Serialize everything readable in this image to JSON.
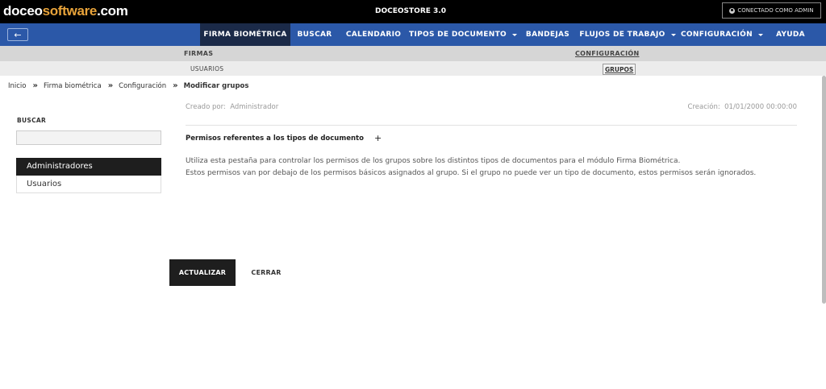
{
  "topbar": {
    "logo_main": "doceo",
    "logo_accent": "software",
    "logo_suffix": ".com",
    "app_title": "DOCEOSTORE 3.0",
    "connected_label": "CONECTADO COMO ADMIN"
  },
  "nav": {
    "items": [
      {
        "label": "FIRMA BIOMÉTRICA",
        "active": true,
        "dropdown": false
      },
      {
        "label": "BUSCAR",
        "active": false,
        "dropdown": false
      },
      {
        "label": "CALENDARIO",
        "active": false,
        "dropdown": false
      },
      {
        "label": "TIPOS DE DOCUMENTO",
        "active": false,
        "dropdown": true
      },
      {
        "label": "BANDEJAS",
        "active": false,
        "dropdown": false
      },
      {
        "label": "FLUJOS DE TRABAJO",
        "active": false,
        "dropdown": true
      },
      {
        "label": "CONFIGURACIÓN",
        "active": false,
        "dropdown": true
      },
      {
        "label": "AYUDA",
        "active": false,
        "dropdown": false
      }
    ]
  },
  "subnav": {
    "firmas": "FIRMAS",
    "configuracion": "CONFIGURACIÓN",
    "usuarios": "USUARIOS",
    "grupos": "GRUPOS"
  },
  "breadcrumb": {
    "items": [
      "Inicio",
      "Firma biométrica",
      "Configuración"
    ],
    "current": "Modificar grupos"
  },
  "sidebar": {
    "search_label": "BUSCAR",
    "search_value": "",
    "groups": [
      "Administradores",
      "Usuarios"
    ],
    "selected_index": 0
  },
  "main": {
    "created_by_label": "Creado por:",
    "created_by_value": "Administrador",
    "creation_label": "Creación:",
    "creation_value": "01/01/2000 00:00:00",
    "section_title": "Permisos referentes a los tipos de documento",
    "desc_line1": "Utiliza esta pestaña para controlar los permisos de los grupos sobre los distintos tipos de documentos para el módulo Firma Biométrica.",
    "desc_line2": "Estos permisos van por debajo de los permisos básicos asignados al grupo. Si el grupo no puede ver un tipo de documento, estos permisos serán ignorados."
  },
  "actions": {
    "update_label": "ACTUALIZAR",
    "close_label": "CERRAR"
  }
}
